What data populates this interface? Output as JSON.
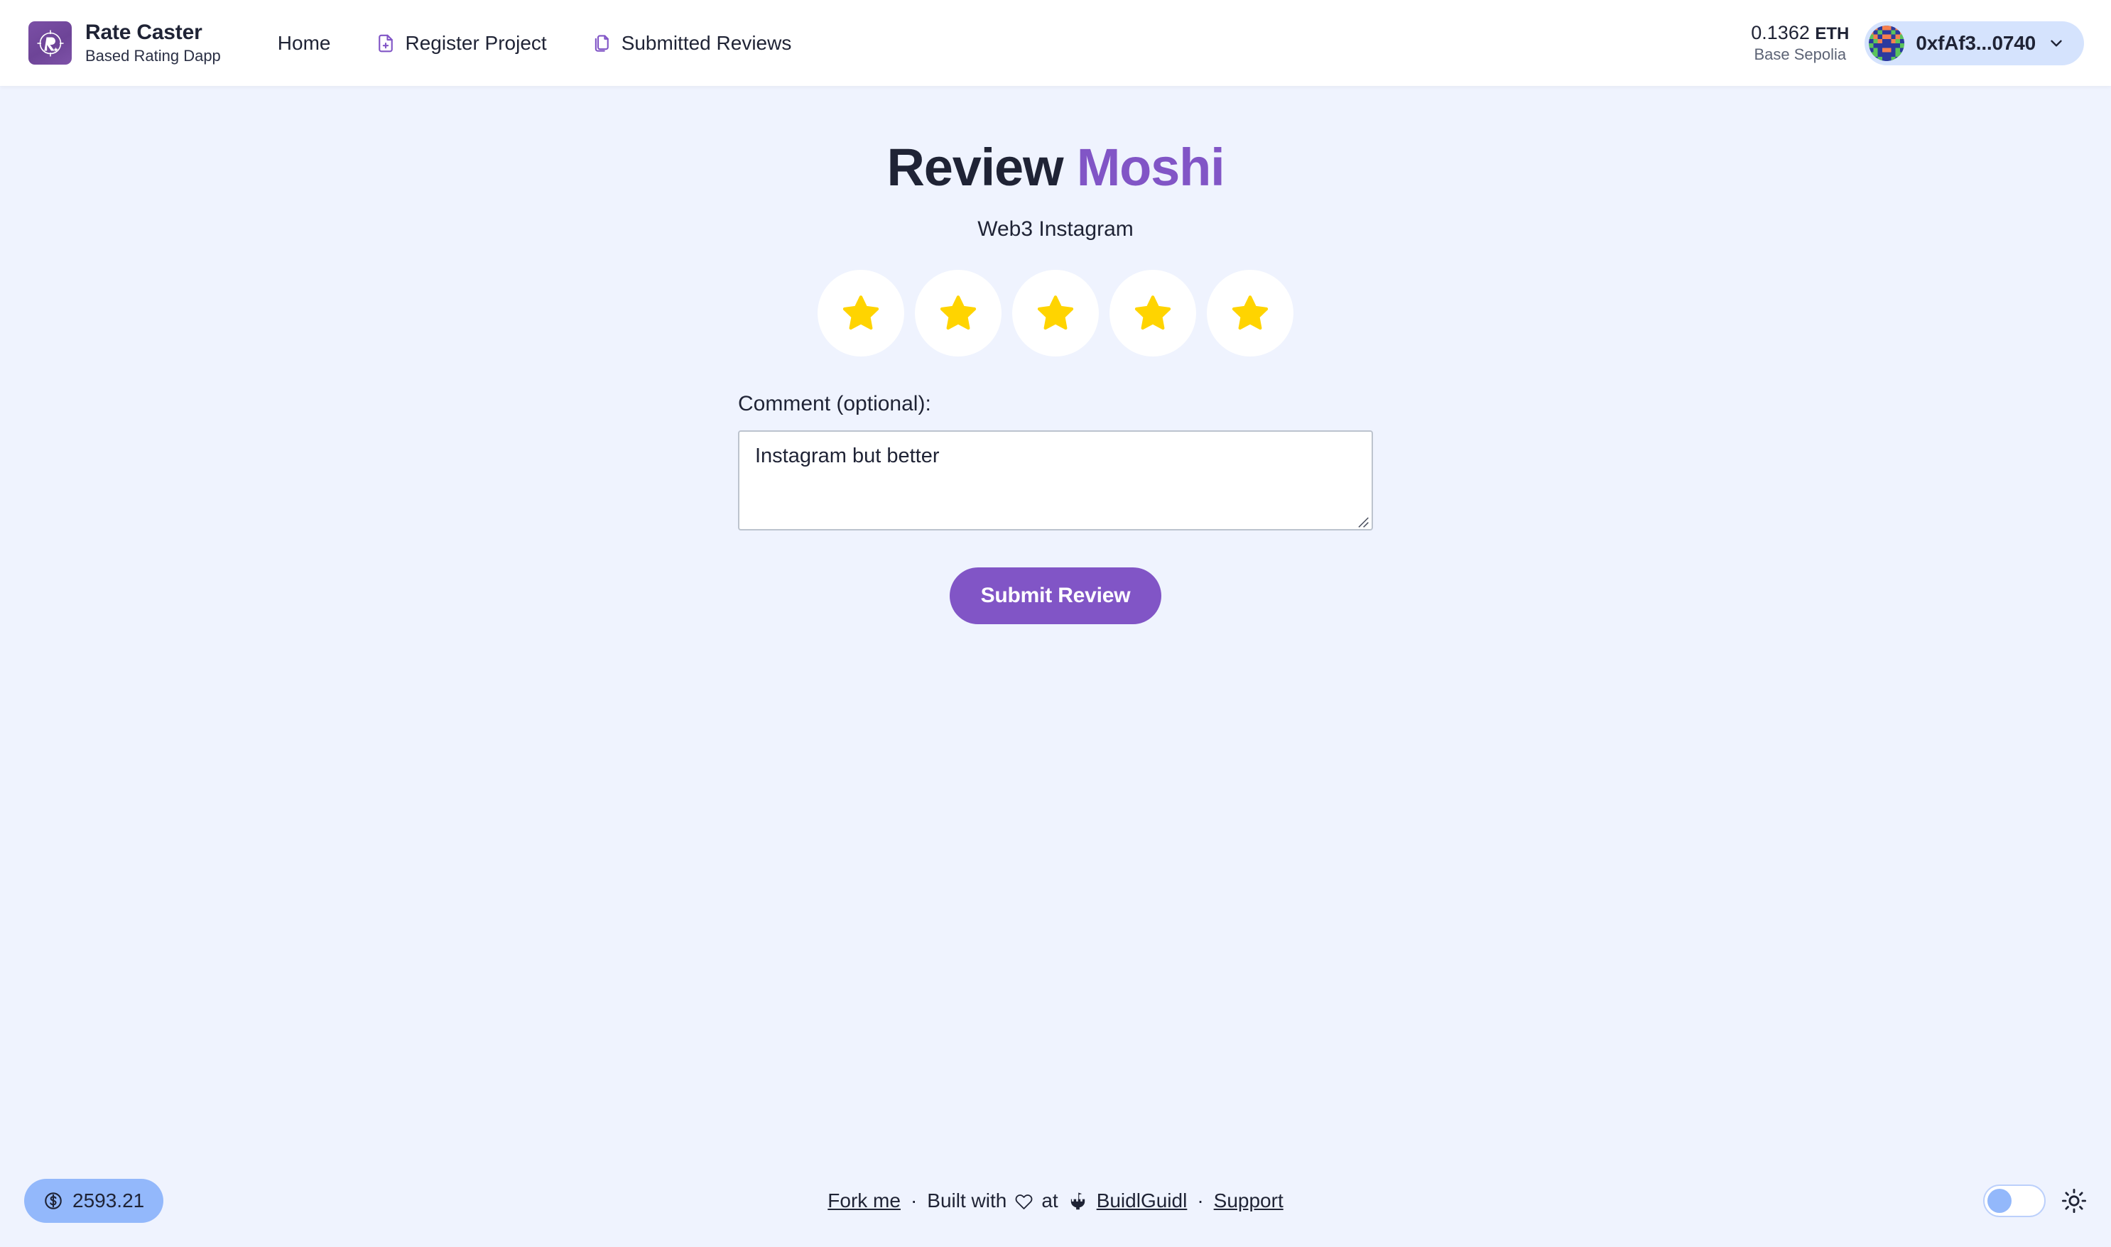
{
  "header": {
    "brand": {
      "title": "Rate Caster",
      "subtitle": "Based Rating Dapp",
      "logo_icon": "rate-caster-r-logo"
    },
    "nav": [
      {
        "label": "Home",
        "icon": ""
      },
      {
        "label": "Register Project",
        "icon": "document-plus-icon"
      },
      {
        "label": "Submitted Reviews",
        "icon": "documents-copy-icon"
      }
    ],
    "wallet": {
      "balance_amount": "0.1362",
      "balance_symbol": "ETH",
      "network": "Base Sepolia",
      "address": "0xfAf3...0740",
      "avatar_icon": "blockie-avatar",
      "chevron_icon": "chevron-down-icon",
      "pill_color": "#d5e3fd"
    }
  },
  "main": {
    "title_prefix": "Review ",
    "title_project": "Moshi",
    "subtitle": "Web3 Instagram",
    "accent_color": "#8155c6",
    "rating": {
      "value": 5,
      "max": 5,
      "star_icon": "star-filled-icon",
      "star_color": "#FFD400"
    },
    "comment": {
      "label": "Comment (optional):",
      "value": "Instagram but better",
      "placeholder": ""
    },
    "submit_label": "Submit Review"
  },
  "footer": {
    "price": {
      "icon": "dollar-circle-icon",
      "value": "2593.21"
    },
    "links": {
      "fork": "Fork me",
      "dot1": "·",
      "built_with": "Built with",
      "heart_icon": "heart-icon",
      "at": "at",
      "castle_icon": "buidlguidl-castle-icon",
      "buidlguidl": "BuidlGuidl",
      "dot2": "·",
      "support": "Support"
    },
    "theme": {
      "toggle_state": "light",
      "sun_icon": "sun-icon"
    }
  }
}
